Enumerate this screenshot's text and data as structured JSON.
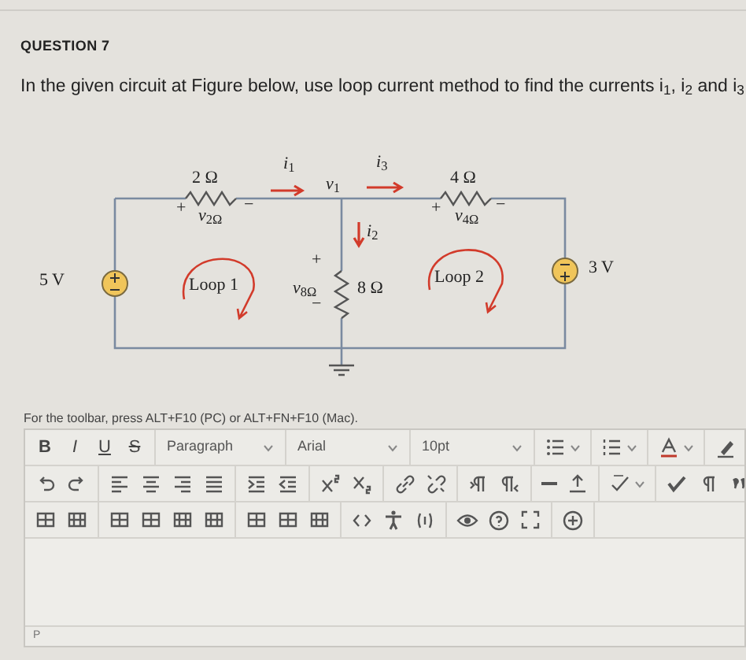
{
  "question": {
    "number": "QUESTION 7",
    "text": "In the given circuit at Figure below, use loop current method to find the currents i$_{1}$, i$_{2}$ and i$_{3}$"
  },
  "figure": {
    "labels": [
      {
        "text": "2 Ω"
      },
      {
        "text": "*i*$_{1}$"
      },
      {
        "text": "*v*$_{1}$"
      },
      {
        "text": "*i*$_{3}$"
      },
      {
        "text": "4 Ω"
      },
      {
        "text": "+"
      },
      {
        "text": "*v*$_{2Ω}$"
      },
      {
        "text": "−"
      },
      {
        "text": "+"
      },
      {
        "text": "*v*$_{4Ω}$"
      },
      {
        "text": "−"
      },
      {
        "text": "*i*$_{2}$"
      },
      {
        "text": "5 V"
      },
      {
        "text": "3 V"
      },
      {
        "text": "Loop 1"
      },
      {
        "text": "*v*$_{8Ω}$"
      },
      {
        "text": "+"
      },
      {
        "text": "−"
      },
      {
        "text": "8 Ω"
      },
      {
        "text": "Loop 2"
      }
    ]
  },
  "editor": {
    "hint": "For the toolbar, press ALT+F10 (PC) or ALT+FN+F10 (Mac).",
    "rows": [
      [
        [
          {
            "kind": "bold",
            "label": "B"
          },
          {
            "kind": "italic",
            "label": "I"
          },
          {
            "kind": "underline",
            "label": "U"
          },
          {
            "kind": "strike",
            "label": "S"
          }
        ],
        [
          {
            "kind": "select",
            "label": "Paragraph"
          }
        ],
        [
          {
            "kind": "select",
            "label": "Arial"
          }
        ],
        [
          {
            "kind": "select",
            "label": "10pt"
          }
        ],
        [
          {
            "kind": "bullet-list"
          }
        ],
        [
          {
            "kind": "numbered-list"
          }
        ],
        [
          {
            "kind": "text-color"
          }
        ],
        [
          {
            "kind": "highlight"
          }
        ]
      ],
      [
        [
          {
            "kind": "undo"
          },
          {
            "kind": "redo"
          }
        ],
        [
          {
            "kind": "align-left"
          },
          {
            "kind": "align-center"
          },
          {
            "kind": "align-right"
          },
          {
            "kind": "justify"
          }
        ],
        [
          {
            "kind": "indent"
          },
          {
            "kind": "outdent"
          }
        ],
        [
          {
            "kind": "superscript"
          },
          {
            "kind": "subscript"
          }
        ],
        [
          {
            "kind": "link"
          },
          {
            "kind": "unlink"
          }
        ],
        [
          {
            "kind": "ltr"
          },
          {
            "kind": "rtl"
          }
        ],
        [
          {
            "kind": "rule"
          },
          {
            "kind": "upload"
          }
        ],
        [
          {
            "kind": "spellcheck"
          }
        ],
        [
          {
            "kind": "check"
          },
          {
            "kind": "pilcrow"
          },
          {
            "kind": "quote"
          }
        ]
      ],
      [
        [
          {
            "kind": "table"
          },
          {
            "kind": "table-cells"
          }
        ],
        [
          {
            "kind": "table"
          },
          {
            "kind": "table"
          },
          {
            "kind": "table-cells"
          },
          {
            "kind": "table-cells"
          }
        ],
        [
          {
            "kind": "table"
          },
          {
            "kind": "table"
          },
          {
            "kind": "table-cells"
          }
        ],
        [
          {
            "kind": "code"
          },
          {
            "kind": "accessibility"
          },
          {
            "kind": "math"
          }
        ],
        [
          {
            "kind": "preview"
          },
          {
            "kind": "help"
          },
          {
            "kind": "fullscreen"
          }
        ],
        [
          {
            "kind": "add"
          }
        ]
      ]
    ],
    "status": "P"
  }
}
